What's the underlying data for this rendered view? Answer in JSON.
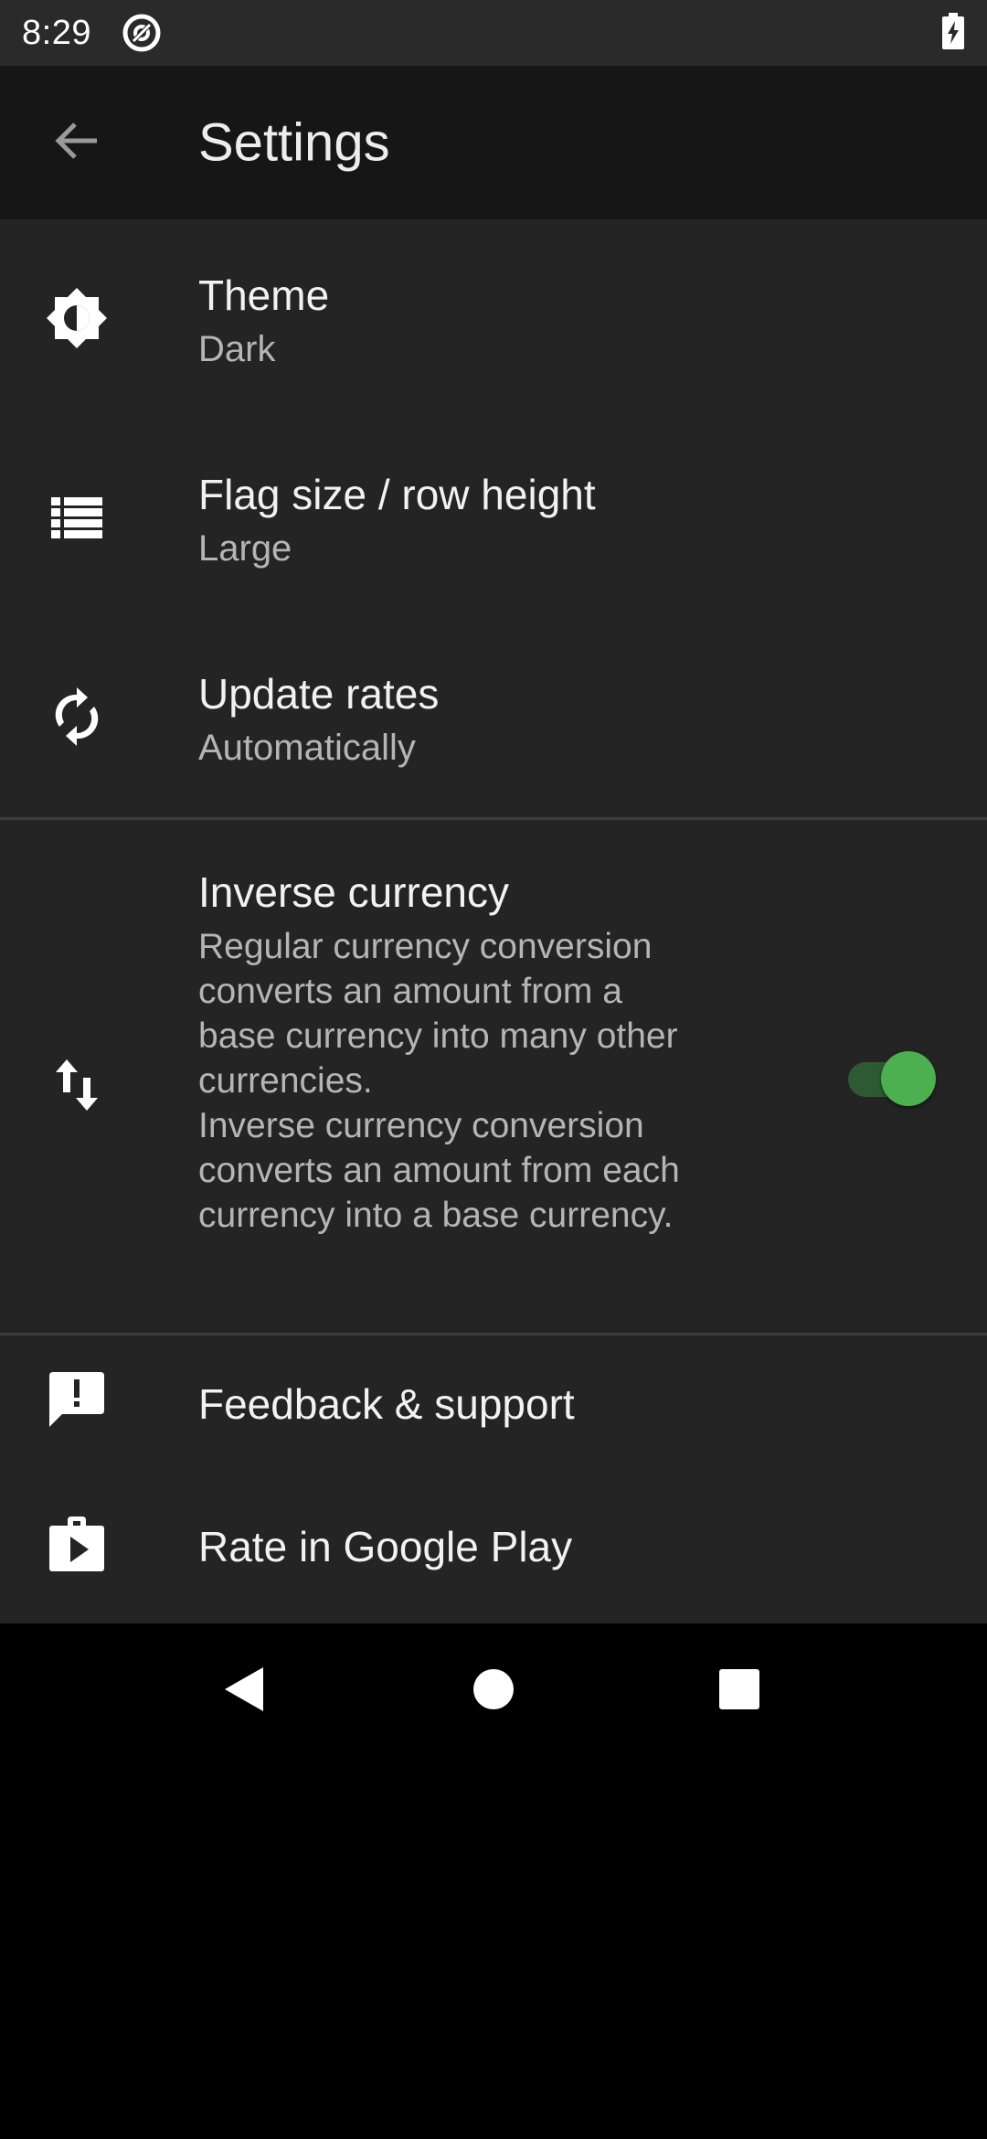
{
  "status_bar": {
    "time": "8:29",
    "left_icon": "at-sign-icon",
    "battery_icon": "battery-charging-icon"
  },
  "app_bar": {
    "back_icon": "arrow-back-icon",
    "title": "Settings"
  },
  "settings": {
    "theme": {
      "icon": "brightness-icon",
      "title": "Theme",
      "value": "Dark"
    },
    "flag_size": {
      "icon": "list-icon",
      "title": "Flag size / row height",
      "value": "Large"
    },
    "update_rates": {
      "icon": "sync-icon",
      "title": "Update rates",
      "value": "Automatically"
    },
    "inverse_currency": {
      "icon": "swap-vertical-icon",
      "title": "Inverse currency",
      "desc_lines_1": [
        "Regular currency conversion",
        "converts an amount from a",
        "base currency into many other",
        "currencies."
      ],
      "desc_lines_2": [
        "Inverse currency conversion",
        "converts an amount from each",
        "currency into a base currency."
      ],
      "enabled": true
    },
    "feedback": {
      "icon": "feedback-icon",
      "title": "Feedback & support"
    },
    "rate": {
      "icon": "google-play-icon",
      "title": "Rate in Google Play"
    }
  },
  "colors": {
    "accent": "#4caf50",
    "background": "#242424",
    "app_bar": "#161616"
  }
}
